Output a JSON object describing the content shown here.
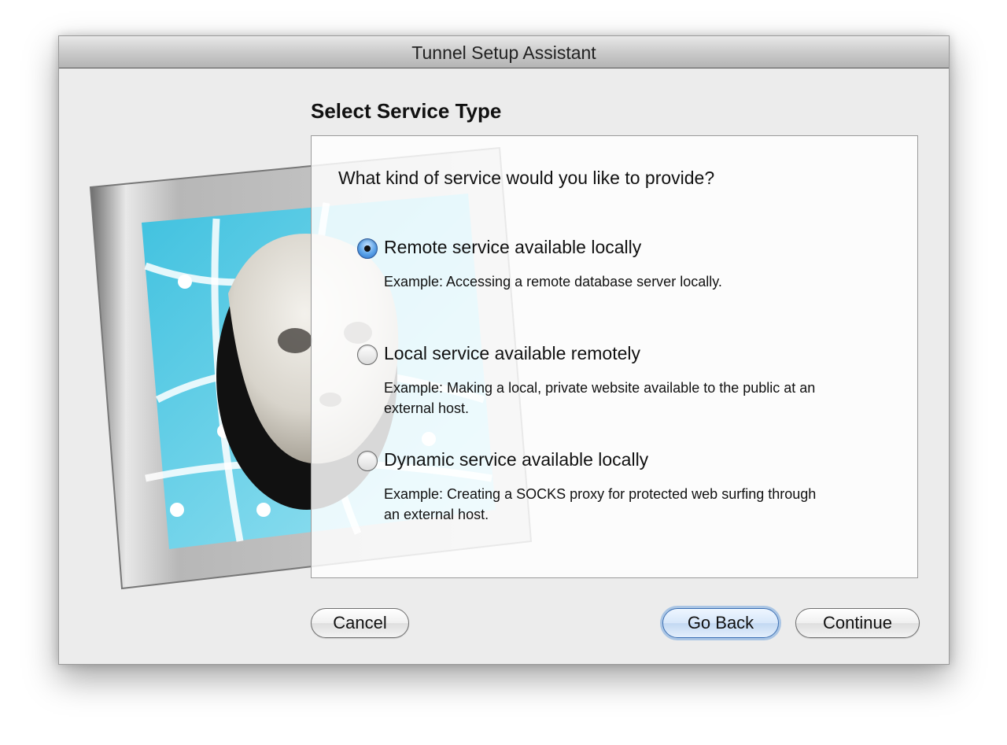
{
  "window": {
    "title": "Tunnel Setup Assistant"
  },
  "content": {
    "heading": "Select Service Type",
    "question": "What kind of service would you like to provide?",
    "options": [
      {
        "label": "Remote service available locally",
        "description": "Example: Accessing a remote database server locally.",
        "selected": true
      },
      {
        "label": "Local service available remotely",
        "description": "Example: Making a local, private website available to the public at an external host.",
        "selected": false
      },
      {
        "label": "Dynamic service available locally",
        "description": "Example: Creating a SOCKS proxy for protected web surfing through an external host.",
        "selected": false
      }
    ]
  },
  "buttons": {
    "cancel": "Cancel",
    "go_back": "Go Back",
    "continue": "Continue"
  },
  "icons": {
    "artwork": "meerkat-in-monitor-icon",
    "radio": "radio-button-icon"
  },
  "colors": {
    "accent": "#5aa2e8",
    "window_bg": "#ececec"
  }
}
